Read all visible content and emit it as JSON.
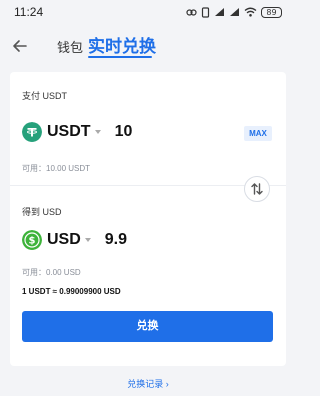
{
  "status_bar": {
    "time": "11:24",
    "battery": "89"
  },
  "header": {
    "back_icon": "arrow-left-icon",
    "tab_wallet": "钱包",
    "tab_exchange": "实时兑换"
  },
  "pay": {
    "label": "支付 USDT",
    "coin": "USDT",
    "amount": "10",
    "max_label": "MAX",
    "available": "可用：10.00 USDT"
  },
  "receive": {
    "label": "得到 USD",
    "coin": "USD",
    "amount": "9.9",
    "available": "可用：0.00 USD"
  },
  "rate": "1 USDT ≈ 0.99009900 USD",
  "convert_button": "兑换",
  "history_link": "兑换记录",
  "colors": {
    "accent": "#1f6fe8",
    "usdt": "#26a17b",
    "usd": "#3db33a"
  }
}
